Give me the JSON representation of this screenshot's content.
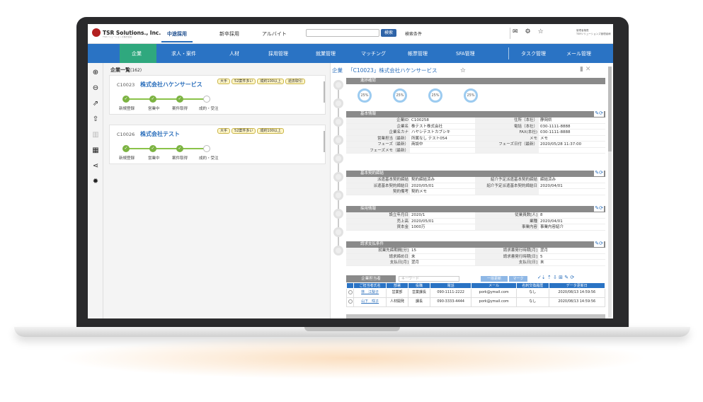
{
  "header": {
    "logo": "TSR Solutions., Inc.",
    "logo_sub": "TSRソリューションズ株式会社",
    "tabs": [
      {
        "label": "中途採用",
        "active": true
      },
      {
        "label": "新卒採用",
        "active": false
      },
      {
        "label": "アルバイト",
        "active": false
      }
    ],
    "search_button": "検索",
    "search_conditions": "検索条件",
    "user_line1": "管理者権限",
    "user_line2": "TSRソリューションズ管理者様"
  },
  "nav": [
    "企業",
    "求人・案件",
    "人材",
    "採用管理",
    "就業管理",
    "マッチング",
    "帳票管理",
    "SFA管理",
    "タスク管理",
    "メール管理"
  ],
  "list": {
    "title": "企業一覧",
    "count": "(162)",
    "cards": [
      {
        "id": "C10023",
        "name": "株式会社ハケンサービス",
        "tags": [
          "大手",
          "52案件多い",
          "成約100以上",
          "過去取引"
        ],
        "steps": [
          "新規登録",
          "営業中",
          "案件取得",
          "成約・受注"
        ],
        "done": 3
      },
      {
        "id": "C10026",
        "name": "株式会社テスト",
        "tags": [
          "大手",
          "52案件多い",
          "成約100以上"
        ],
        "steps": [
          "新規登録",
          "営業中",
          "案件取得",
          "成約・受注"
        ],
        "done": 3
      }
    ]
  },
  "detail": {
    "crumb": "企業",
    "title": "「C10023」株式会社ハケンサービス",
    "progress_title": "進捗確認",
    "progress": [
      "25%",
      "25%",
      "25%",
      "25%"
    ],
    "basic": {
      "title": "基本情報",
      "rows": [
        [
          "企業ID",
          "C100258",
          "住所（本社）",
          "静岡県"
        ],
        [
          "企業名",
          "株テスト株式会社",
          "電話（本社）",
          "030-1111-8888"
        ],
        [
          "企業名カナ",
          "ハヤシテストカブシキ",
          "FAX(本社)",
          "030-1111-8888"
        ],
        [
          "営業担当（最新）",
          "所属なし テスト054",
          "メモ",
          "メモ"
        ],
        [
          "フェーズ（最新）",
          "商談中",
          "フェーズ日付（最新）",
          "2020/05/28 11:37:00"
        ],
        [
          "フェーズメモ（最新）",
          "",
          "",
          ""
        ]
      ]
    },
    "contract": {
      "title": "基本契約締結",
      "rows": [
        [
          "派遣基本契約締結",
          "契約締結済み",
          "紹介予定派遣基本契約締結",
          "締結済み"
        ],
        [
          "派遣基本契約締結日",
          "2020/05/01",
          "紹介予定派遣基本契約締結日",
          "2020/04/01"
        ],
        [
          "契約備考",
          "契約メモ",
          "",
          ""
        ]
      ]
    },
    "hiring": {
      "title": "採用情報",
      "rows": [
        [
          "設立年月日",
          "2020/1",
          "従業員数[人]",
          "8"
        ],
        [
          "売上高",
          "2020/05/01",
          "業種",
          "2020/04/01"
        ],
        [
          "資本金",
          "1000万",
          "事業内容",
          "事業内容紹介"
        ]
      ]
    },
    "billing": {
      "title": "請求支払条件",
      "rows": [
        [
          "就業先締期間[分]",
          "15",
          "請求書発行時期[月]",
          "翌月"
        ],
        [
          "請求締め日",
          "末",
          "請求書発行時期[日]",
          "5"
        ],
        [
          "支払日[月]",
          "翌月",
          "支払日[日]",
          "末"
        ]
      ]
    },
    "contacts": {
      "label": "企業担当者",
      "keyword_placeholder": "キーワード",
      "btn_bulk": "一括更新",
      "btn_mark": "マーク",
      "headers": [
        "",
        "ご担当者氏名",
        "部署",
        "役職",
        "電話",
        "メール",
        "名刺交換履歴",
        "データ更新日"
      ],
      "rows": [
        [
          "",
          "林　江梨子",
          "営業部",
          "営業課長",
          "090-1111-2222",
          "pork@ymail.com",
          "なし",
          "2020/08/13 14:59:56"
        ],
        [
          "",
          "山下　咲子",
          "人材開発",
          "課長",
          "090-3333-4444",
          "pork@ymail.com",
          "なし",
          "2020/08/13 14:59:56"
        ]
      ]
    }
  }
}
